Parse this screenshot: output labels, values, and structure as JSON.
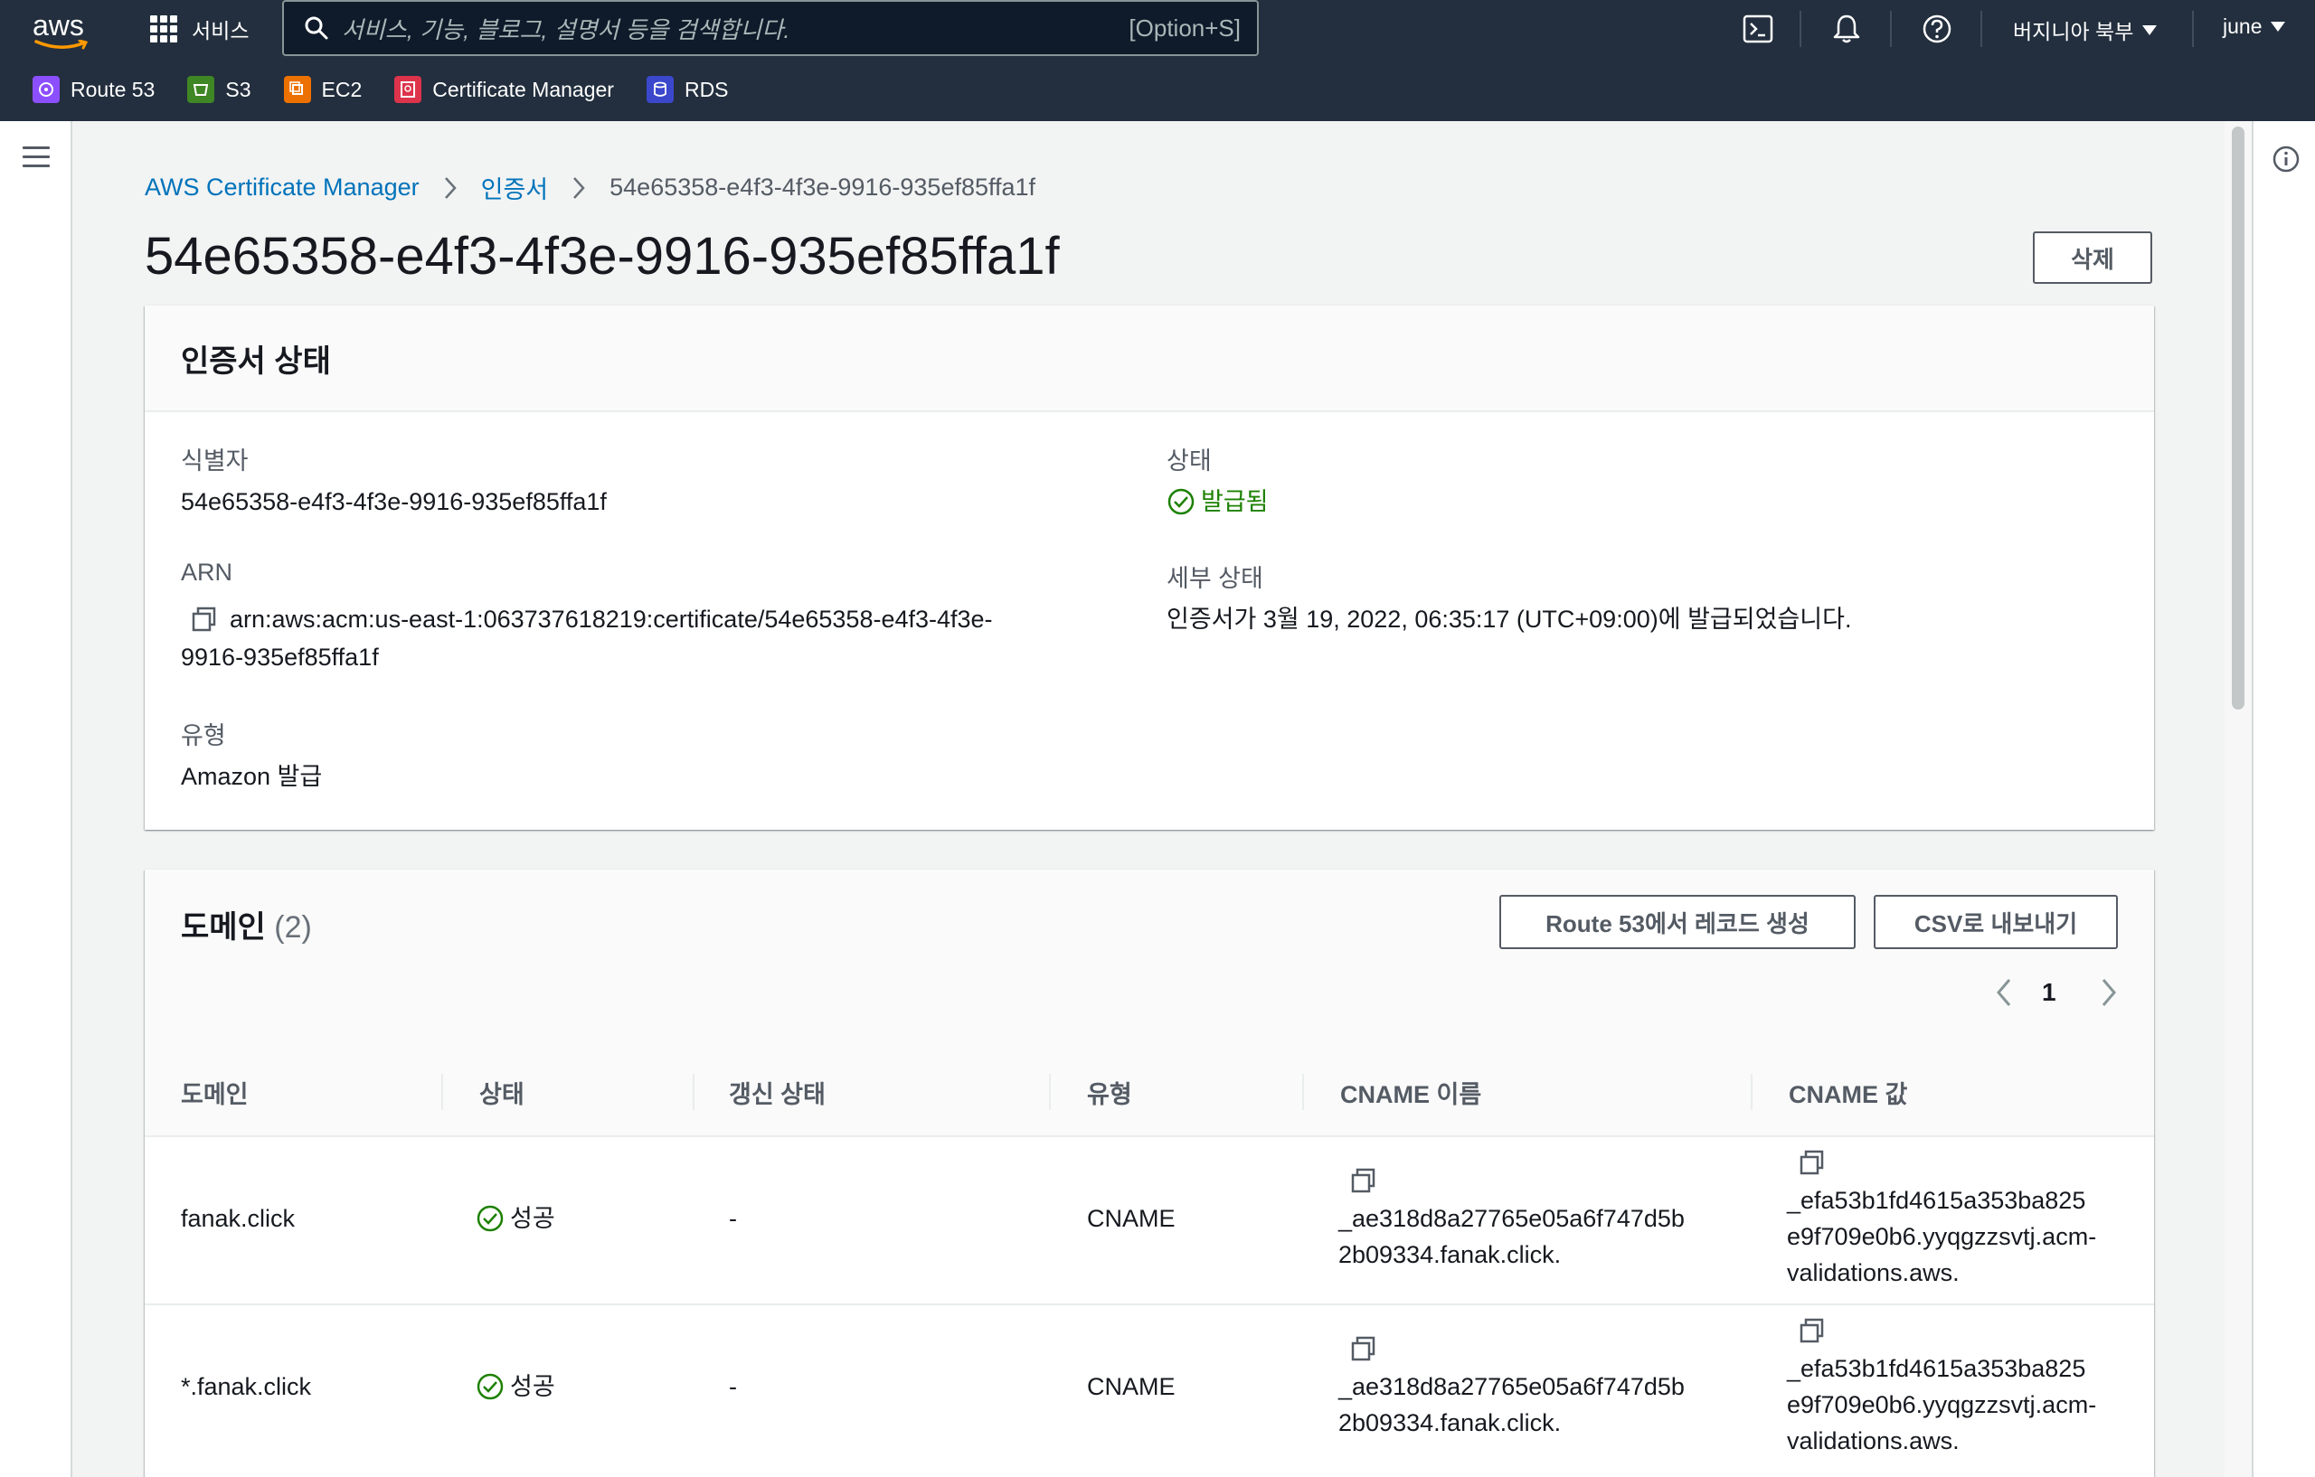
{
  "topnav": {
    "logo": "aws",
    "services_label": "서비스",
    "search_placeholder": "서비스, 기능, 블로그, 설명서 등을 검색합니다.",
    "search_shortcut": "[Option+S]",
    "region_label": "버지니아 북부",
    "user_label": "june",
    "icons": [
      "cloudshell-icon",
      "bell-icon",
      "help-icon"
    ]
  },
  "favorites": [
    {
      "label": "Route 53",
      "color": "#8c4fff"
    },
    {
      "label": "S3",
      "color": "#3f8624"
    },
    {
      "label": "EC2",
      "color": "#ed7100"
    },
    {
      "label": "Certificate Manager",
      "color": "#dd344c"
    },
    {
      "label": "RDS",
      "color": "#3b48cc"
    }
  ],
  "breadcrumb": {
    "root": "AWS Certificate Manager",
    "section": "인증서",
    "current": "54e65358-e4f3-4f3e-9916-935ef85ffa1f"
  },
  "page": {
    "title": "54e65358-e4f3-4f3e-9916-935ef85ffa1f",
    "delete_label": "삭제"
  },
  "cert_status": {
    "title": "인증서 상태",
    "identifier_label": "식별자",
    "identifier_value": "54e65358-e4f3-4f3e-9916-935ef85ffa1f",
    "arn_label": "ARN",
    "arn_line1": "arn:aws:acm:us-east-1:063737618219:certificate/54e65358-e4f3-4f3e-",
    "arn_line2": "9916-935ef85ffa1f",
    "type_label": "유형",
    "type_value": "Amazon 발급",
    "status_label": "상태",
    "status_value": "발급됨",
    "detail_label": "세부 상태",
    "detail_value": "인증서가 3월 19, 2022, 06:35:17 (UTC+09:00)에 발급되었습니다."
  },
  "domains": {
    "title": "도메인",
    "count": "(2)",
    "route53_button": "Route 53에서 레코드 생성",
    "csv_button": "CSV로 내보내기",
    "page_number": "1",
    "columns": [
      "도메인",
      "상태",
      "갱신 상태",
      "유형",
      "CNAME 이름",
      "CNAME 값"
    ],
    "rows": [
      {
        "domain": "fanak.click",
        "status": "성공",
        "renewal": "-",
        "type": "CNAME",
        "cname_name_1": "_ae318d8a27765e05a6f747d5b",
        "cname_name_2": "2b09334.fanak.click.",
        "cname_value_1": "_efa53b1fd4615a353ba825",
        "cname_value_2": "e9f709e0b6.yyqgzzsvtj.acm-",
        "cname_value_3": "validations.aws."
      },
      {
        "domain": "*.fanak.click",
        "status": "성공",
        "renewal": "-",
        "type": "CNAME",
        "cname_name_1": "_ae318d8a27765e05a6f747d5b",
        "cname_name_2": "2b09334.fanak.click.",
        "cname_value_1": "_efa53b1fd4615a353ba825",
        "cname_value_2": "e9f709e0b6.yyqgzzsvtj.acm-",
        "cname_value_3": "validations.aws."
      }
    ]
  },
  "colors": {
    "nav_bg": "#232f3e",
    "link": "#0073bb",
    "success": "#1d8102"
  }
}
